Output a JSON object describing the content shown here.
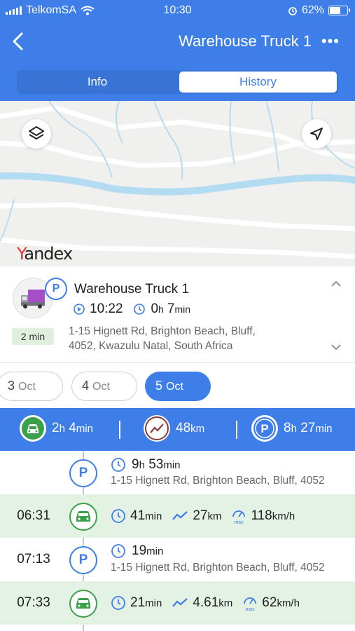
{
  "status_bar": {
    "carrier": "TelkomSA",
    "time": "10:30",
    "battery": "62%",
    "battery_level": 0.62
  },
  "header": {
    "title": "Warehouse Truck 1",
    "more": "•••"
  },
  "tabs": [
    {
      "label": "Info",
      "active": false
    },
    {
      "label": "History",
      "active": true
    }
  ],
  "map": {
    "provider_letter": "Y",
    "provider_rest": "andex"
  },
  "vehicle": {
    "name": "Warehouse Truck 1",
    "parked_badge": "P",
    "start_time": "10:22",
    "duration_h": "0",
    "duration_h_unit": "h",
    "duration_min": "7",
    "duration_min_unit": "min",
    "address_line1": "1-15 Hignett Rd, Brighton Beach, Bluff,",
    "address_line2": "4052, Kwazulu Natal, South Africa",
    "age_badge": "2 min"
  },
  "dates": [
    {
      "day": "3",
      "month": "Oct",
      "active": false
    },
    {
      "day": "4",
      "month": "Oct",
      "active": false
    },
    {
      "day": "5",
      "month": "Oct",
      "active": true
    }
  ],
  "summary": {
    "drive_h": "2",
    "drive_h_unit": "h",
    "drive_min": "4",
    "drive_min_unit": "min",
    "distance": "48",
    "distance_unit": "km",
    "park_icon": "P",
    "park_h": "8",
    "park_h_unit": "h",
    "park_min": "27",
    "park_min_unit": "min"
  },
  "history": [
    {
      "type": "park",
      "time": "",
      "icon": "P",
      "dur_a": "9",
      "dur_a_unit": "h",
      "dur_b": "53",
      "dur_b_unit": "min",
      "address": "1-15 Hignett Rd, Brighton Beach, Bluff, 4052"
    },
    {
      "type": "drive",
      "time": "06:31",
      "dur": "41",
      "dur_unit": "min",
      "dist": "27",
      "dist_unit": "km",
      "max_label": "max",
      "speed": "118",
      "speed_unit": "km/h"
    },
    {
      "type": "park",
      "time": "07:13",
      "icon": "P",
      "dur_a": "19",
      "dur_a_unit": "min",
      "address": "1-15 Hignett Rd, Brighton Beach, Bluff, 4052"
    },
    {
      "type": "drive",
      "time": "07:33",
      "dur": "21",
      "dur_unit": "min",
      "dist": "4.61",
      "dist_unit": "km",
      "max_label": "max",
      "speed": "62",
      "speed_unit": "km/h"
    }
  ],
  "colors": {
    "accent": "#3d7ee8",
    "drive": "#3aa04a",
    "drive_bg": "#e4f2e4",
    "trend": "#8b3a3a"
  }
}
